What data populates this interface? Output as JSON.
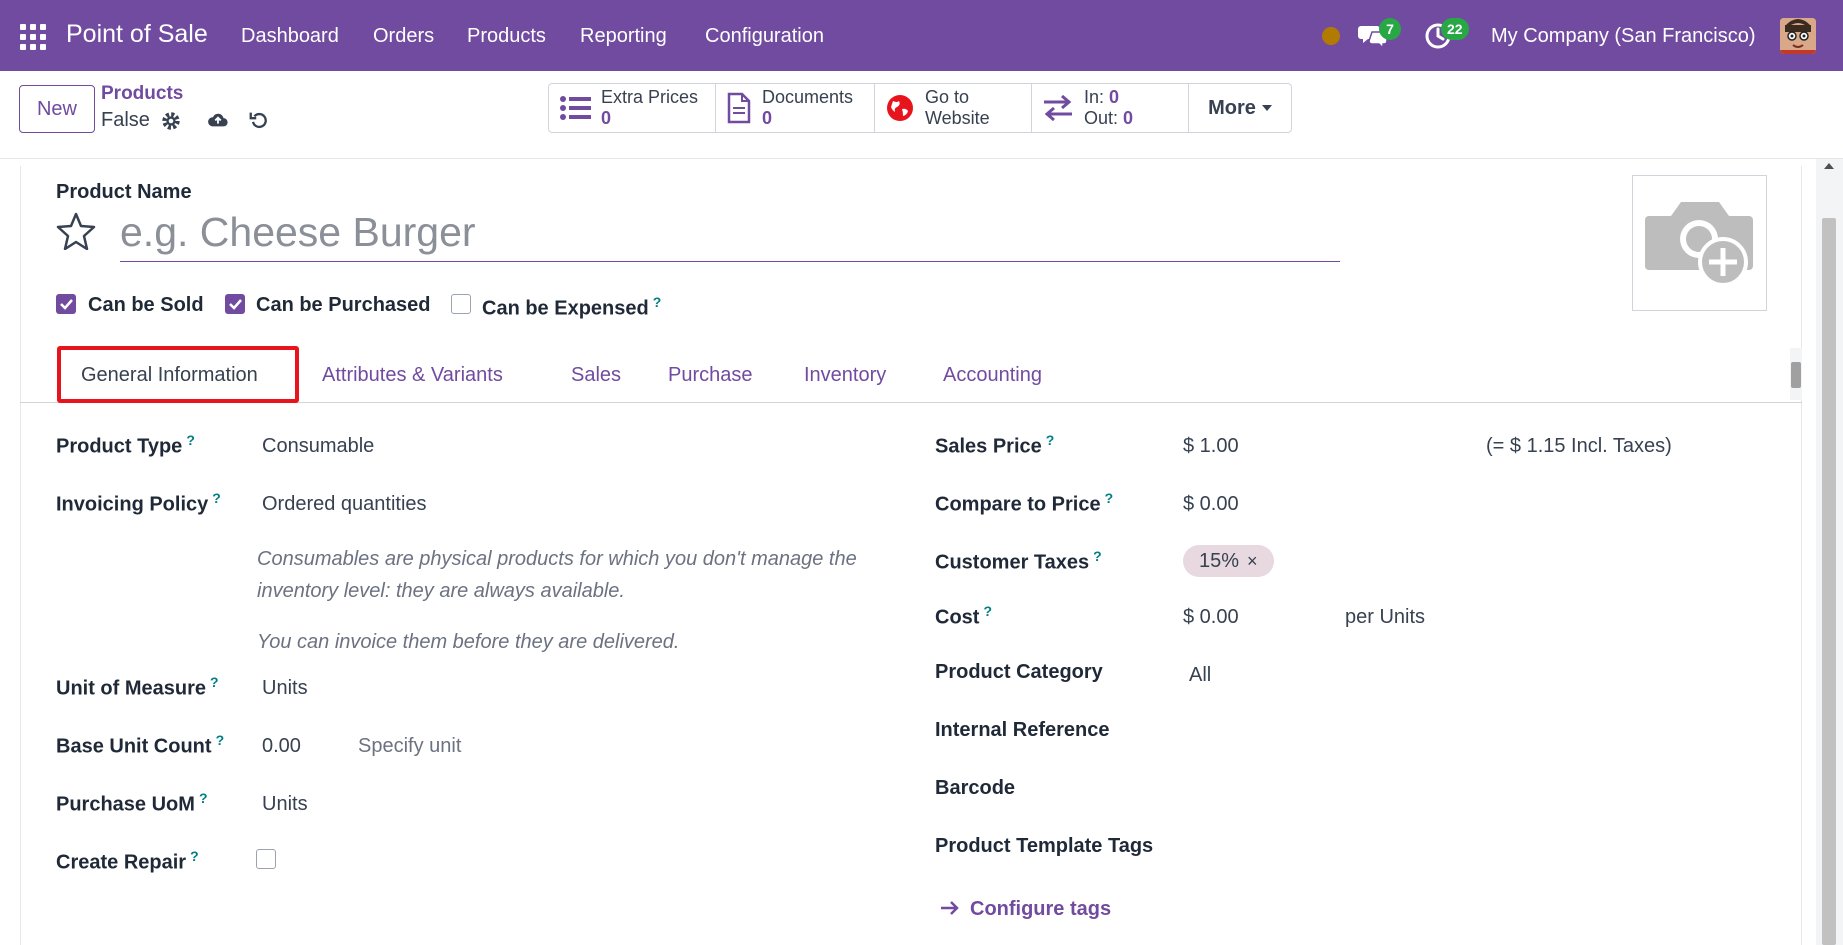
{
  "navbar": {
    "brand": "Point of Sale",
    "menu": [
      "Dashboard",
      "Orders",
      "Products",
      "Reporting",
      "Configuration"
    ],
    "messages_count": "7",
    "activities_count": "22",
    "company": "My Company (San Francisco)"
  },
  "control": {
    "new_label": "New",
    "breadcrumb": "Products",
    "record_name": "False",
    "smart_buttons": {
      "extra_prices": {
        "label": "Extra Prices",
        "value": "0"
      },
      "documents": {
        "label": "Documents",
        "value": "0"
      },
      "website": {
        "line1": "Go to",
        "line2": "Website"
      },
      "moves": {
        "in_label": "In:",
        "in_value": "0",
        "out_label": "Out:",
        "out_value": "0"
      },
      "more": "More"
    }
  },
  "form": {
    "product_name_label": "Product Name",
    "product_name_placeholder": "e.g. Cheese Burger",
    "checkboxes": [
      {
        "label": "Can be Sold",
        "checked": true
      },
      {
        "label": "Can be Purchased",
        "checked": true
      },
      {
        "label": "Can be Expensed",
        "checked": false,
        "help": "?"
      }
    ],
    "tabs": [
      "General Information",
      "Attributes & Variants",
      "Sales",
      "Purchase",
      "Inventory",
      "Accounting"
    ],
    "active_tab": "General Information",
    "left": {
      "product_type": {
        "label": "Product Type",
        "help": "?",
        "value": "Consumable"
      },
      "invoicing_policy": {
        "label": "Invoicing Policy",
        "help": "?",
        "value": "Ordered quantities"
      },
      "help_line_1": "Consumables are physical products for which you don't manage the",
      "help_line_2": "inventory level: they are always available.",
      "help_line_3": "You can invoice them before they are delivered.",
      "uom": {
        "label": "Unit of Measure",
        "help": "?",
        "value": "Units"
      },
      "base_unit_count": {
        "label": "Base Unit Count",
        "help": "?",
        "value": "0.00",
        "placeholder": "Specify unit"
      },
      "purchase_uom": {
        "label": "Purchase UoM",
        "help": "?",
        "value": "Units"
      },
      "create_repair": {
        "label": "Create Repair",
        "help": "?"
      }
    },
    "right": {
      "sales_price": {
        "label": "Sales Price",
        "help": "?",
        "value": "$ 1.00",
        "incl": "(= $ 1.15 Incl. Taxes)"
      },
      "compare_price": {
        "label": "Compare to Price",
        "help": "?",
        "value": "$ 0.00"
      },
      "customer_taxes": {
        "label": "Customer Taxes",
        "help": "?",
        "tag": "15%",
        "tag_remove": "×"
      },
      "cost": {
        "label": "Cost",
        "help": "?",
        "value": "$ 0.00",
        "unit": "per Units"
      },
      "product_category": {
        "label": "Product Category",
        "value": "All"
      },
      "internal_reference": {
        "label": "Internal Reference"
      },
      "barcode": {
        "label": "Barcode"
      },
      "template_tags": {
        "label": "Product Template Tags"
      },
      "configure_tags": "Configure tags"
    }
  },
  "colors": {
    "brand": "#714B9F",
    "highlight": "#E8141D",
    "badge": "#28A745",
    "help": "#017E84"
  }
}
